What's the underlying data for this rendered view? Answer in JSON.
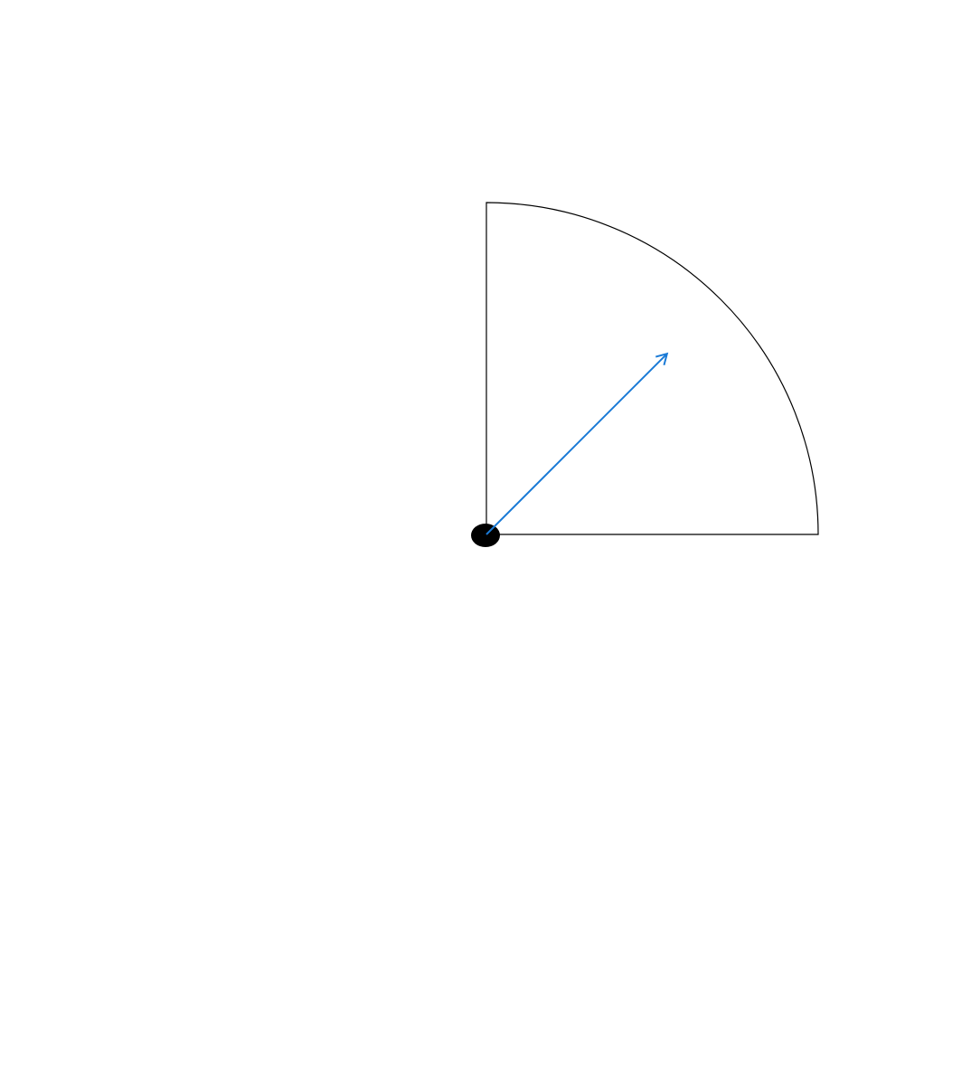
{
  "diagram": {
    "shape": "quarter-circle sector",
    "sweep_degrees": 90,
    "vector_direction_degrees": 45,
    "vector_length_fraction_of_radius": 0.77,
    "colors": {
      "background": "#ffffff",
      "outline": "#000000",
      "vector": "#1a7ad6",
      "origin_marker": "#000000"
    }
  }
}
